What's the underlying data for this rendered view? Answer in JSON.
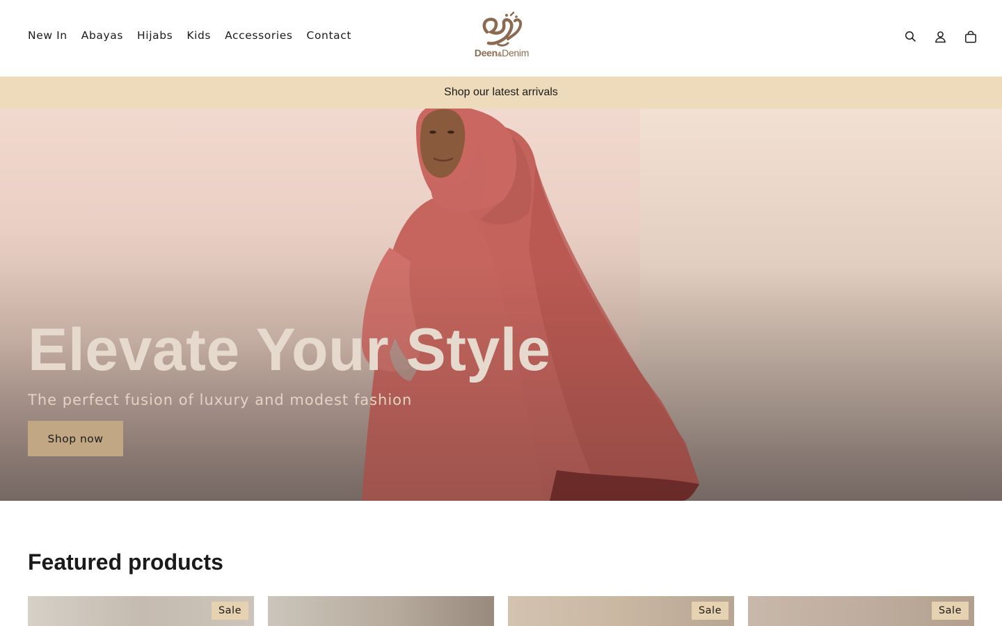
{
  "brand": {
    "logo_text_primary": "Deen",
    "logo_text_amp": "&",
    "logo_text_secondary": "Denim",
    "accent_color": "#8b6a4f"
  },
  "nav": {
    "items": [
      {
        "label": "New In"
      },
      {
        "label": "Abayas"
      },
      {
        "label": "Hijabs"
      },
      {
        "label": "Kids"
      },
      {
        "label": "Accessories"
      },
      {
        "label": "Contact"
      }
    ]
  },
  "header_icons": [
    "search-icon",
    "account-icon",
    "cart-icon"
  ],
  "announcement": {
    "text": "Shop our latest arrivals",
    "background": "#eedbbb"
  },
  "hero": {
    "title": "Elevate Your Style",
    "subtitle": "The perfect fusion of luxury and modest fashion",
    "button_label": "Shop now",
    "button_color": "#c2a784"
  },
  "featured": {
    "title": "Featured products",
    "products": [
      {
        "badge": "Sale"
      },
      {
        "badge": ""
      },
      {
        "badge": "Sale"
      },
      {
        "badge": "Sale"
      }
    ],
    "badge_color": "#e6d2b0"
  }
}
